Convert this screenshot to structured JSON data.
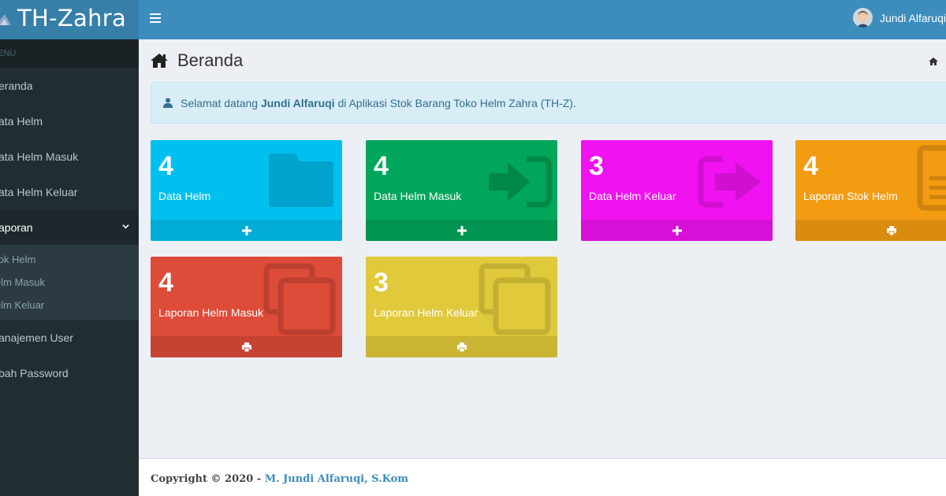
{
  "app": {
    "title": "TH-Zahra"
  },
  "header": {
    "user_name": "Jundi Alfaruqi"
  },
  "sidebar": {
    "menu_header": "ENU",
    "items": [
      {
        "label": "eranda"
      },
      {
        "label": "ata Helm"
      },
      {
        "label": "ata Helm Masuk"
      },
      {
        "label": "ata Helm Keluar"
      },
      {
        "label": "aporan",
        "expanded": true
      }
    ],
    "subitems": [
      {
        "label": "tok Helm"
      },
      {
        "label": "elm Masuk"
      },
      {
        "label": "elm Keluar"
      }
    ],
    "items_after": [
      {
        "label": "anajemen User"
      },
      {
        "label": "bah Password"
      }
    ]
  },
  "content": {
    "page_title": "Beranda",
    "callout": {
      "prefix": "Selamat datang ",
      "user": "Jundi Alfaruqi",
      "suffix": " di Aplikasi Stok Barang Toko Helm Zahra (TH-Z)."
    }
  },
  "boxes": [
    {
      "value": "4",
      "title": "Data Helm",
      "color": "#00c0ef",
      "icon": "folder-icon",
      "footer_icon": "plus-icon"
    },
    {
      "value": "4",
      "title": "Data Helm Masuk",
      "color": "#00a65a",
      "icon": "sign-in-icon",
      "footer_icon": "plus-icon"
    },
    {
      "value": "3",
      "title": "Data Helm Keluar",
      "color": "#f012f0",
      "icon": "sign-out-icon",
      "footer_icon": "plus-icon"
    },
    {
      "value": "4",
      "title": "Laporan Stok Helm",
      "color": "#f39c12",
      "icon": "file-text-icon",
      "footer_icon": "print-icon"
    },
    {
      "value": "4",
      "title": "Laporan Helm Masuk",
      "color": "#dd4b39",
      "icon": "clone-icon",
      "footer_icon": "print-icon"
    },
    {
      "value": "3",
      "title": "Laporan Helm Keluar",
      "color": "#e0c93a",
      "icon": "clone-icon",
      "footer_icon": "print-icon"
    }
  ],
  "footer": {
    "copyright": "Copyright © 2020 - ",
    "author": "M. Jundi Alfaruqi, S.Kom"
  }
}
